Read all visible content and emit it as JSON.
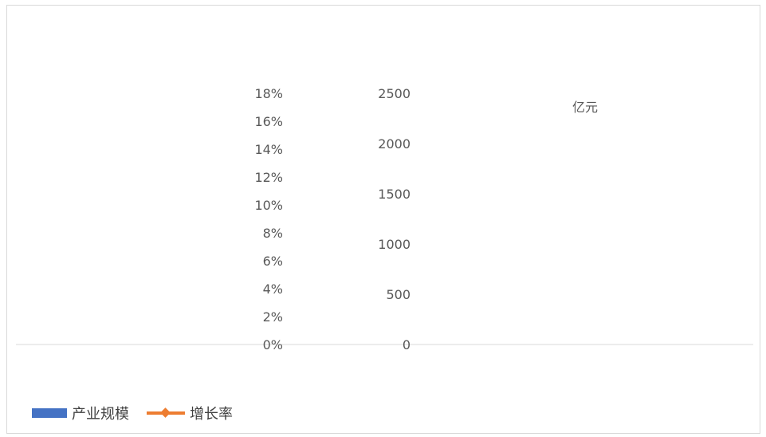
{
  "chart_data": {
    "type": "bar",
    "title": "",
    "unit_label": "亿元",
    "categories": [],
    "series": [
      {
        "name": "产业规模",
        "type": "bar",
        "axis": "right",
        "values": []
      },
      {
        "name": "增长率",
        "type": "line",
        "axis": "left",
        "values": []
      }
    ],
    "y_left": {
      "ylim": [
        0,
        0.18
      ],
      "ticks": [
        "0%",
        "2%",
        "4%",
        "6%",
        "8%",
        "10%",
        "12%",
        "14%",
        "16%",
        "18%"
      ]
    },
    "y_right": {
      "ylim": [
        0,
        2500
      ],
      "ticks": [
        "0",
        "500",
        "1000",
        "1500",
        "2000",
        "2500"
      ]
    },
    "grid": false,
    "legend_position": "bottom-left"
  },
  "colors": {
    "bar": "#4472C4",
    "line": "#ED7D31"
  },
  "legend": {
    "bar_label": "产业规模",
    "line_label": "增长率"
  }
}
